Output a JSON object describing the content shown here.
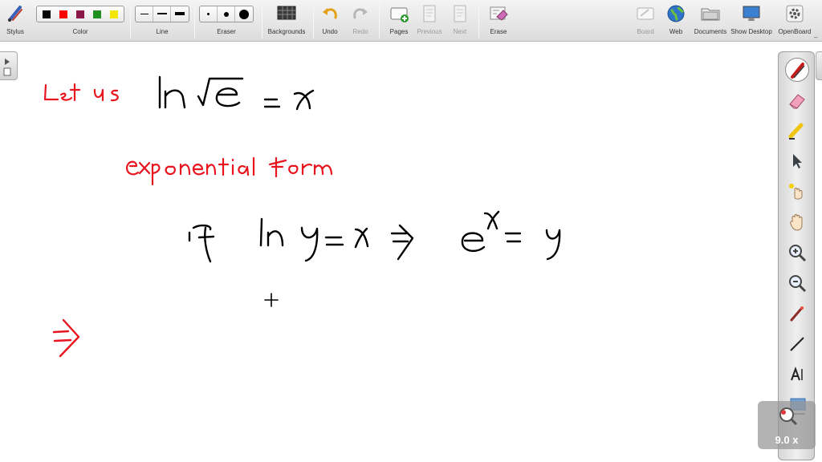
{
  "toolbar": {
    "stylus": "Stylus",
    "color": "Color",
    "line": "Line",
    "eraser": "Eraser",
    "backgrounds": "Backgrounds",
    "undo": "Undo",
    "redo": "Redo",
    "pages": "Pages",
    "previous": "Previous",
    "next": "Next",
    "erase": "Erase",
    "board": "Board",
    "web": "Web",
    "documents": "Documents",
    "show_desktop": "Show Desktop",
    "openboard": "OpenBoard"
  },
  "colors": {
    "swatches": [
      "#000000",
      "#ff0000",
      "#8b1a4a",
      "#1f8f1f",
      "#f5e600"
    ],
    "ink_black": "#000000",
    "ink_red": "#e8141e"
  },
  "icons": {
    "stylus": "pen-icon",
    "backgrounds": "grid-background-icon",
    "undo": "undo-arrow-icon",
    "redo": "redo-arrow-icon",
    "pages": "add-page-icon",
    "erase": "erase-board-icon",
    "web": "globe-icon",
    "documents": "folder-icon",
    "show_desktop": "monitor-icon",
    "openboard": "gear-icon"
  },
  "dock_tools": [
    "pen",
    "eraser",
    "marker",
    "selector",
    "laser-pointer",
    "hand",
    "zoom-in",
    "zoom-out",
    "pointer",
    "line",
    "text",
    "capture"
  ],
  "zoom": {
    "label": "9.0 x"
  },
  "board": {
    "handwritten_lines": [
      "Let us   ln √e = x",
      "exponential form",
      "If  ln y = x  ⇒  e^x = y",
      "⇒"
    ]
  }
}
